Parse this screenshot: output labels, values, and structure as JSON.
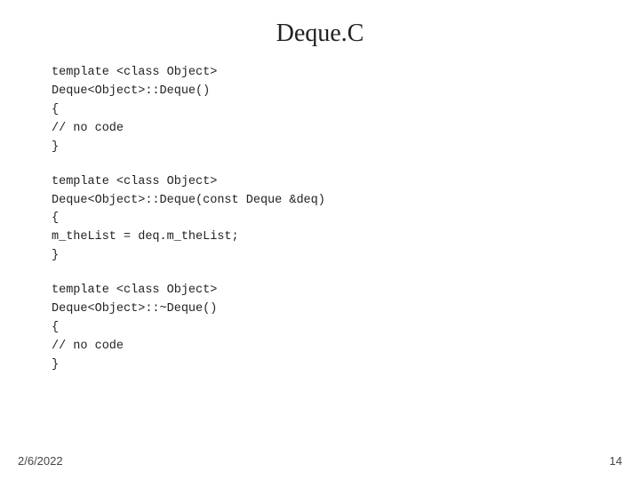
{
  "title": "Deque.C",
  "code_blocks": [
    {
      "lines": [
        "template <class Object>",
        "Deque<Object>::Deque()",
        "{",
        "   // no code",
        "}"
      ]
    },
    {
      "lines": [
        "template <class Object>",
        "Deque<Object>::Deque(const Deque &deq)",
        "{",
        "   m_theList = deq.m_theList;",
        "}"
      ]
    },
    {
      "lines": [
        "template <class Object>",
        "Deque<Object>::~Deque()",
        "{",
        "   // no code",
        "}"
      ]
    }
  ],
  "footer": {
    "date": "2/6/2022",
    "page": "14"
  }
}
